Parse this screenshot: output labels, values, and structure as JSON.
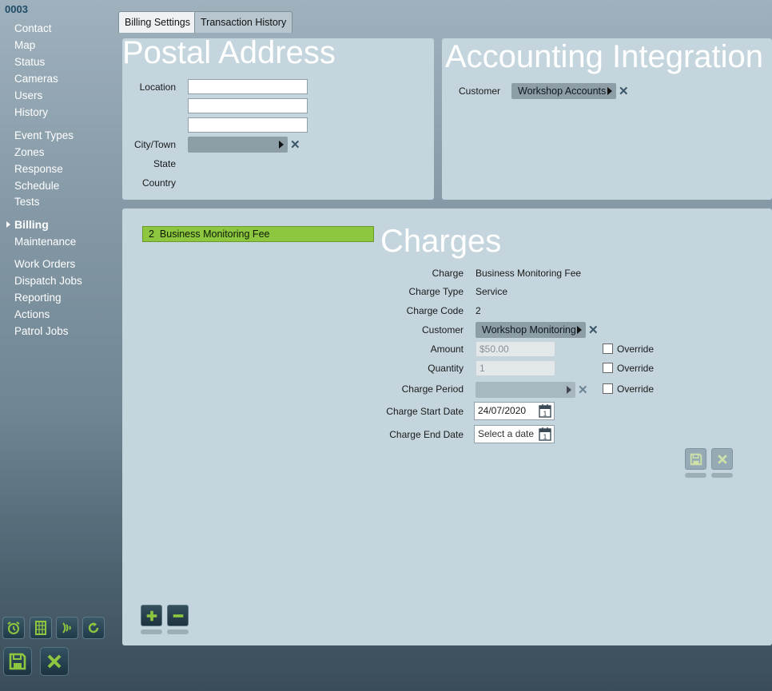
{
  "account": {
    "id": "0003"
  },
  "nav": {
    "items": [
      {
        "label": "Contact"
      },
      {
        "label": "Map"
      },
      {
        "label": "Status"
      },
      {
        "label": "Cameras"
      },
      {
        "label": "Users"
      },
      {
        "label": "History"
      },
      {
        "label": "Event Types"
      },
      {
        "label": "Zones"
      },
      {
        "label": "Response"
      },
      {
        "label": "Schedule"
      },
      {
        "label": "Tests"
      },
      {
        "label": "Billing"
      },
      {
        "label": "Maintenance"
      },
      {
        "label": "Work Orders"
      },
      {
        "label": "Dispatch Jobs"
      },
      {
        "label": "Reporting"
      },
      {
        "label": "Actions"
      },
      {
        "label": "Patrol Jobs"
      }
    ],
    "active": "Billing"
  },
  "tabs": [
    {
      "label": "Billing Settings",
      "active": true
    },
    {
      "label": "Transaction History",
      "active": false
    }
  ],
  "postal": {
    "title": "Postal Address",
    "location_label": "Location",
    "city_label": "City/Town",
    "state_label": "State",
    "country_label": "Country",
    "location_line1": "",
    "location_line2": "",
    "location_line3": "",
    "city_value": ""
  },
  "accounting": {
    "title": "Accounting Integration",
    "customer_label": "Customer",
    "customer_value": "Workshop Accounts"
  },
  "charges": {
    "title": "Charges",
    "list": [
      {
        "code": "2",
        "name": "Business Monitoring Fee",
        "selected": true
      }
    ],
    "charge_label": "Charge",
    "charge_value": "Business Monitoring Fee",
    "type_label": "Charge Type",
    "type_value": "Service",
    "code_label": "Charge Code",
    "code_value": "2",
    "customer_label": "Customer",
    "customer_value": "Workshop Monitoring",
    "amount_label": "Amount",
    "amount_value": "$50.00",
    "quantity_label": "Quantity",
    "quantity_value": "1",
    "period_label": "Charge Period",
    "period_value": "",
    "override_label": "Override",
    "start_label": "Charge Start Date",
    "start_value": "24/07/2020",
    "end_label": "Charge End Date",
    "end_placeholder": "Select a date"
  },
  "icons": {
    "accent_green": "#8dc73f",
    "nav_arrow": "triangle-right-icon"
  }
}
